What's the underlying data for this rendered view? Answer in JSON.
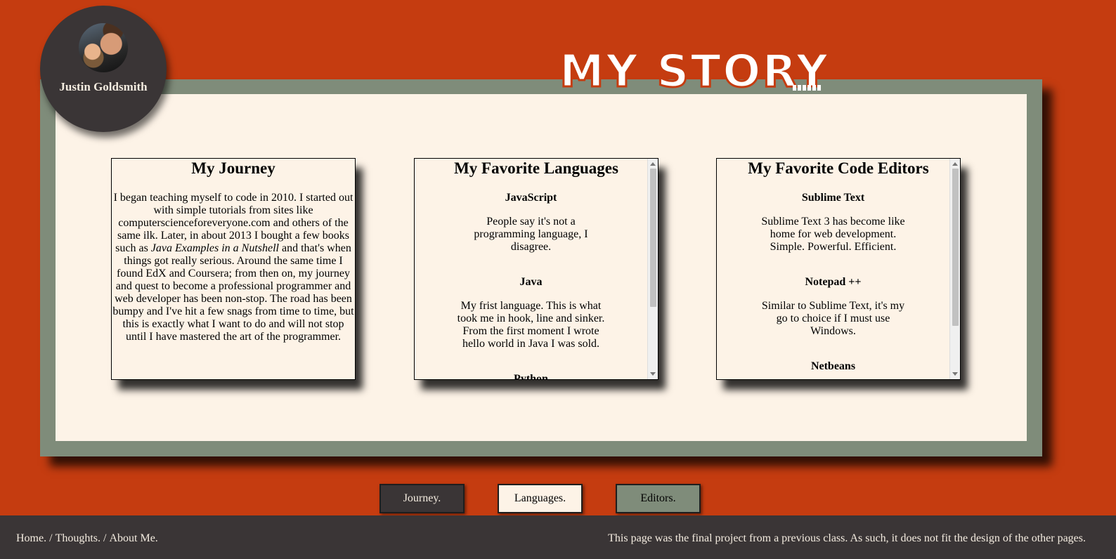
{
  "profile": {
    "name": "Justin Goldsmith"
  },
  "header": {
    "title": "MY STORY"
  },
  "cards": {
    "journey": {
      "title": "My Journey",
      "text_before_em": "I began teaching myself to code in 2010. I started out with simple tutorials from sites like computerscienceforeveryone.com and others of the same ilk. Later, in about 2013 I bought a few books such as ",
      "em": "Java Examples in a Nutshell",
      "text_after_em": " and that's when things got really serious. Around the same time I found EdX and Coursera; from then on, my journey and quest to become a professional programmer and web developer has been non-stop. The road has been bumpy and I've hit a few snags from time to time, but this is exactly what I want to do and will not stop until I have mastered the art of the programmer."
    },
    "languages": {
      "title": "My Favorite Languages",
      "items": [
        {
          "name": "JavaScript",
          "text": "People say it's not a programming language, I disagree."
        },
        {
          "name": "Java",
          "text": "My frist language. This is what took me in hook, line and sinker. From the first moment I wrote hello world in Java I was sold."
        },
        {
          "name": "Python",
          "text": ""
        }
      ]
    },
    "editors": {
      "title": "My Favorite Code Editors",
      "items": [
        {
          "name": "Sublime Text",
          "text": "Sublime Text 3 has become like home for web development. Simple. Powerful. Efficient."
        },
        {
          "name": "Notepad ++",
          "text": "Similar to Sublime Text, it's my go to choice if I must use Windows."
        },
        {
          "name": "Netbeans",
          "text": ""
        }
      ]
    }
  },
  "buttons": {
    "journey": "Journey.",
    "languages": "Languages.",
    "editors": "Editors."
  },
  "footer": {
    "home": "Home.",
    "sep1": " / ",
    "thoughts": "Thoughts.",
    "sep2": " / ",
    "about": "About Me.",
    "note": "This page was the final project from a previous class. As such, it does not fit the design of the other pages."
  },
  "colors": {
    "background": "#c53c10",
    "frame": "#7f8c7a",
    "paper": "#fdf3e7",
    "dark": "#3a3536"
  }
}
